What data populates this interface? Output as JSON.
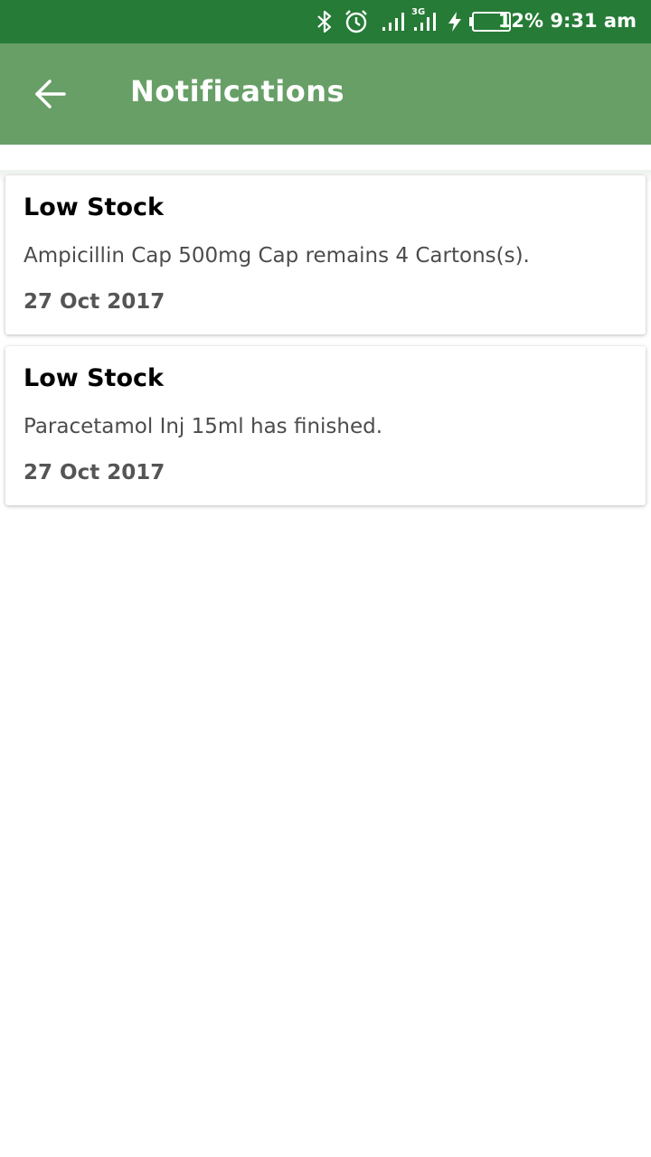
{
  "status_bar": {
    "battery_percent_text": "12%",
    "time": "9:31 am",
    "network_label": "3G",
    "battery_level": 0.12,
    "icons": [
      "bluetooth-icon",
      "alarm-icon",
      "signal-icon",
      "signal-3g-icon",
      "charging-icon",
      "battery-icon"
    ]
  },
  "app_bar": {
    "title": "Notifications",
    "back_icon": "arrow-back-icon"
  },
  "notifications": [
    {
      "title": "Low Stock",
      "message": "Ampicillin Cap 500mg Cap remains 4 Cartons(s).",
      "date": "27 Oct 2017"
    },
    {
      "title": "Low Stock",
      "message": "Paracetamol Inj 15ml has finished.",
      "date": "27 Oct 2017"
    }
  ],
  "colors": {
    "status_bar": "#267b36",
    "app_bar": "#689f67",
    "battery_fill": "#2ecc40"
  }
}
